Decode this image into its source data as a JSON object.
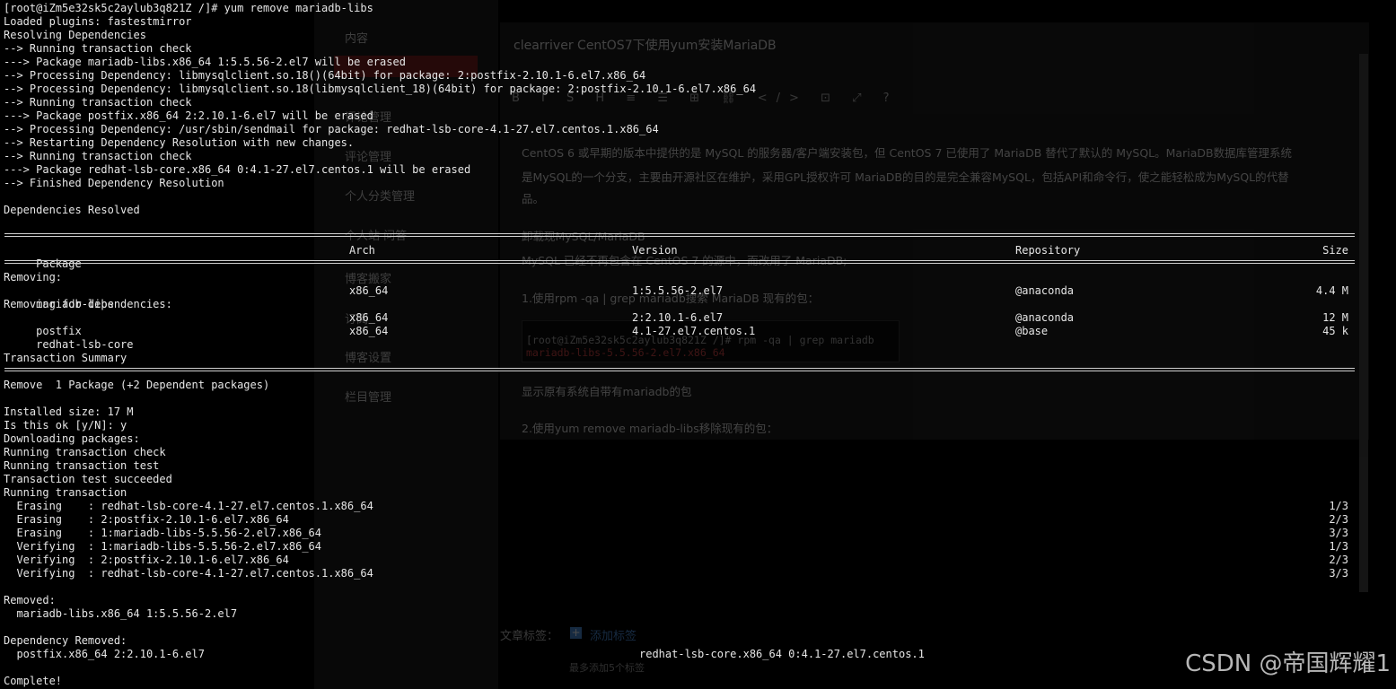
{
  "terminal": {
    "prompt_line": "[root@iZm5e32sk5c2aylub3q821Z /]# yum remove mariadb-libs",
    "pre_lines": [
      "Loaded plugins: fastestmirror",
      "Resolving Dependencies",
      "--> Running transaction check",
      "---> Package mariadb-libs.x86_64 1:5.5.56-2.el7 will be erased",
      "--> Processing Dependency: libmysqlclient.so.18()(64bit) for package: 2:postfix-2.10.1-6.el7.x86_64",
      "--> Processing Dependency: libmysqlclient.so.18(libmysqlclient_18)(64bit) for package: 2:postfix-2.10.1-6.el7.x86_64",
      "--> Running transaction check",
      "---> Package postfix.x86_64 2:2.10.1-6.el7 will be erased",
      "--> Processing Dependency: /usr/sbin/sendmail for package: redhat-lsb-core-4.1-27.el7.centos.1.x86_64",
      "--> Restarting Dependency Resolution with new changes.",
      "--> Running transaction check",
      "---> Package redhat-lsb-core.x86_64 0:4.1-27.el7.centos.1 will be erased",
      "--> Finished Dependency Resolution",
      "",
      "Dependencies Resolved",
      ""
    ],
    "table_header": {
      "package": " Package",
      "arch": "Arch",
      "version": "Version",
      "repository": "Repository",
      "size": "Size"
    },
    "removing_label": "Removing:",
    "removing_deps_label": "Removing for dependencies:",
    "packages": [
      {
        "name": " mariadb-libs",
        "arch": "x86_64",
        "version": "1:5.5.56-2.el7",
        "repo": "@anaconda",
        "size": "4.4 M"
      },
      {
        "name": " postfix",
        "arch": "x86_64",
        "version": "2:2.10.1-6.el7",
        "repo": "@anaconda",
        "size": "12 M"
      },
      {
        "name": " redhat-lsb-core",
        "arch": "x86_64",
        "version": "4.1-27.el7.centos.1",
        "repo": "@base",
        "size": "45 k"
      }
    ],
    "summary_label": "Transaction Summary",
    "remove_summary": "Remove  1 Package (+2 Dependent packages)",
    "post_lines": [
      "Installed size: 17 M",
      "Is this ok [y/N]: y",
      "Downloading packages:",
      "Running transaction check",
      "Running transaction test",
      "Transaction test succeeded",
      "Running transaction"
    ],
    "progress": [
      {
        "text": "  Erasing    : redhat-lsb-core-4.1-27.el7.centos.1.x86_64",
        "count": "1/3"
      },
      {
        "text": "  Erasing    : 2:postfix-2.10.1-6.el7.x86_64",
        "count": "2/3"
      },
      {
        "text": "  Erasing    : 1:mariadb-libs-5.5.56-2.el7.x86_64",
        "count": "3/3"
      },
      {
        "text": "  Verifying  : 1:mariadb-libs-5.5.56-2.el7.x86_64",
        "count": "1/3"
      },
      {
        "text": "  Verifying  : 2:postfix-2.10.1-6.el7.x86_64",
        "count": "2/3"
      },
      {
        "text": "  Verifying  : redhat-lsb-core-4.1-27.el7.centos.1.x86_64",
        "count": "3/3"
      }
    ],
    "removed_label": "Removed:",
    "removed_item": "  mariadb-libs.x86_64 1:5.5.56-2.el7",
    "dep_removed_label": "Dependency Removed:",
    "dep_removed_left": "  postfix.x86_64 2:2.10.1-6.el7",
    "dep_removed_right": "redhat-lsb-core.x86_64 0:4.1-27.el7.centos.1",
    "complete": "Complete!"
  },
  "background_editor": {
    "sidebar_items": [
      "内容",
      "评论管理",
      "评论管理",
      "个人分类管理",
      "个人站 问答",
      "博客搬家",
      "订阅",
      "博客设置",
      "栏目管理"
    ],
    "article_title": "clearriver CentOS7下使用yum安装MariaDB",
    "toolbar_glyphs": "B I S H ≡ ☰ ⊞ ⛓ </> ⊡ ⤢ ?",
    "paragraphs": [
      "CentOS 6 或早期的版本中提供的是 MySQL 的服务器/客户端安装包，但 CentOS 7 已使用了 MariaDB 替代了默认的 MySQL。MariaDB数据库管理系统",
      "是MySQL的一个分支，主要由开源社区在维护，采用GPL授权许可 MariaDB的目的是完全兼容MySQL，包括API和命令行，使之能轻松成为MySQL的代替",
      "品。",
      "卸载现MySQL/MariaDB",
      "MySQL 已经不再包含在 CentOS 7 的源中，而改用了 MariaDB;",
      "1.使用rpm -qa | grep mariadb搜索 MariaDB 现有的包：",
      "显示原有系统自带有mariadb的包",
      "2.使用yum remove mariadb-libs移除现有的包："
    ],
    "code_lines": [
      "[root@iZm5e32sk5c2aylub3q821Z /]# rpm -qa | grep mariadb",
      "mariadb-libs-5.5.56-2.el7.x86_64"
    ],
    "tags_label": "文章标签：",
    "tags_add": "添加标签",
    "tags_hint": "最多添加5个标签"
  },
  "watermark": "CSDN @帝国辉耀1"
}
